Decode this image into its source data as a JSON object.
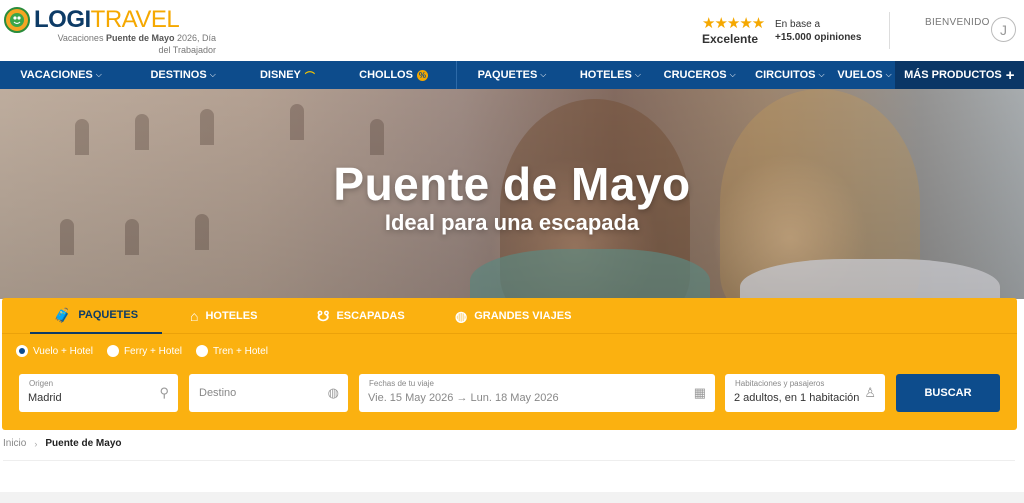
{
  "brand": {
    "logo_logi": "LOGI",
    "logo_travel": "TRAVEL",
    "tagline_pre": "Vacaciones ",
    "tagline_bold": "Puente de Mayo",
    "tagline_post": " 2026, Día del Trabajador"
  },
  "rating": {
    "stars": "★★★★★",
    "label": "Excelente",
    "based_on": "En base a",
    "count": "+15.000 opiniones"
  },
  "account": {
    "welcome": "BIENVENIDO",
    "avatar_initial": "J"
  },
  "nav": {
    "items": [
      {
        "label": "VACACIONES"
      },
      {
        "label": "DESTINOS"
      },
      {
        "label": "DISNEY"
      },
      {
        "label": "CHOLLOS"
      },
      {
        "label": "PAQUETES"
      },
      {
        "label": "HOTELES"
      },
      {
        "label": "CRUCEROS"
      },
      {
        "label": "CIRCUITOS"
      },
      {
        "label": "VUELOS"
      },
      {
        "label": "MÁS PRODUCTOS"
      }
    ]
  },
  "hero": {
    "title": "Puente de Mayo",
    "subtitle": "Ideal para una escapada"
  },
  "search": {
    "tabs": [
      {
        "label": "PAQUETES",
        "icon": "suitcase-icon"
      },
      {
        "label": "HOTELES",
        "icon": "house-icon"
      },
      {
        "label": "ESCAPADAS",
        "icon": "balloon-icon"
      },
      {
        "label": "GRANDES VIAJES",
        "icon": "globe-icon"
      }
    ],
    "modes": [
      "Vuelo + Hotel",
      "Ferry + Hotel",
      "Tren + Hotel"
    ],
    "selected_mode": "Vuelo + Hotel",
    "origin_label": "Origen",
    "origin_value": "Madrid",
    "destination_placeholder": "Destino",
    "dates_label": "Fechas de tu viaje",
    "dates_value": "Vie. 15 May 2026 → Lun. 18 May 2026",
    "rooms_label": "Habitaciones y pasajeros",
    "rooms_value": "2 adultos, en 1 habitación",
    "button_label": "BUSCAR"
  },
  "breadcrumb": {
    "home": "Inicio",
    "current": "Puente de Mayo"
  },
  "colors": {
    "nav_blue": "#0d4c8c",
    "panel_yellow": "#fbb110",
    "brand_dark": "#0d3b66",
    "brand_orange": "#f5a800"
  }
}
